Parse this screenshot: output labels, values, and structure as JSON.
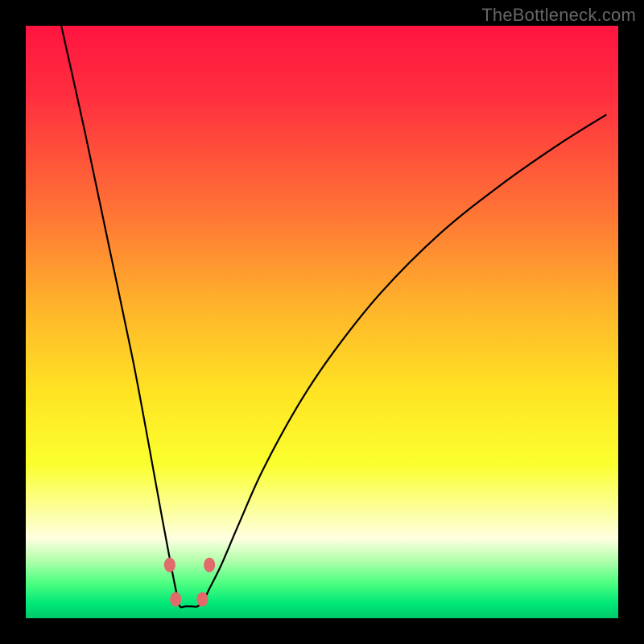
{
  "watermark": "TheBottleneck.com",
  "chart_data": {
    "type": "line",
    "title": "",
    "xlabel": "",
    "ylabel": "",
    "xlim": [
      0,
      100
    ],
    "ylim": [
      0,
      100
    ],
    "grid": false,
    "legend": false,
    "series": [
      {
        "name": "curve",
        "x": [
          6,
          10,
          14,
          18,
          21,
          23,
          24.5,
          25.5,
          26,
          27,
          28,
          29,
          30,
          31,
          33,
          36,
          40,
          46,
          52,
          60,
          70,
          80,
          90,
          98
        ],
        "values": [
          100,
          82,
          63,
          44,
          28,
          17,
          9,
          4,
          2,
          2,
          2,
          2,
          3,
          5,
          9,
          16,
          25,
          36,
          45,
          55,
          65,
          73,
          80,
          85
        ]
      }
    ],
    "markers": [
      {
        "x": 24.3,
        "y": 9
      },
      {
        "x": 25.3,
        "y": 3.2
      },
      {
        "x": 29.8,
        "y": 3.2
      },
      {
        "x": 31.0,
        "y": 9
      }
    ],
    "gradient_stops": [
      {
        "offset": 0.0,
        "color": "#ff1440"
      },
      {
        "offset": 0.12,
        "color": "#ff2f3f"
      },
      {
        "offset": 0.3,
        "color": "#ff6e36"
      },
      {
        "offset": 0.48,
        "color": "#ffb62b"
      },
      {
        "offset": 0.62,
        "color": "#ffe423"
      },
      {
        "offset": 0.74,
        "color": "#fbff2e"
      },
      {
        "offset": 0.82,
        "color": "#fcffa0"
      },
      {
        "offset": 0.865,
        "color": "#ffffe0"
      },
      {
        "offset": 0.9,
        "color": "#b8ffb0"
      },
      {
        "offset": 0.94,
        "color": "#4fff80"
      },
      {
        "offset": 0.975,
        "color": "#00e878"
      },
      {
        "offset": 1.0,
        "color": "#00c96a"
      }
    ],
    "marker_style": {
      "fill": "#e26a6a",
      "rx": 7,
      "ry": 9
    }
  }
}
